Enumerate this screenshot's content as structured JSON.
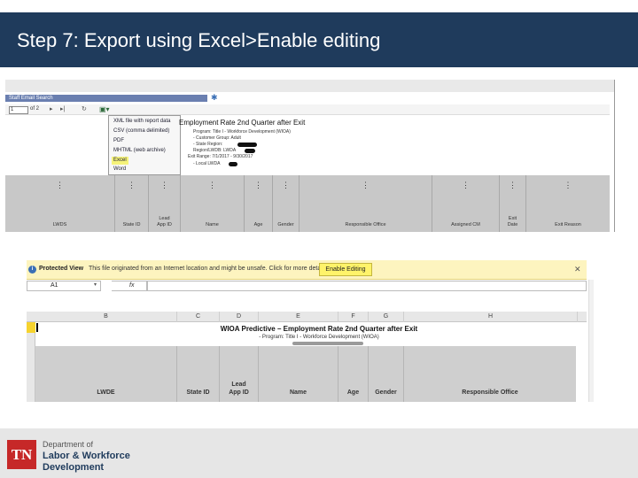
{
  "slide": {
    "title": "Step 7:  Export using Excel>Enable editing"
  },
  "report_viewer": {
    "window_title": "Staff Email Search",
    "page_input": "1",
    "page_of": "of 2",
    "export_menu": [
      "XML file with report data",
      "CSV (comma delimited)",
      "PDF",
      "MHTML (web archive)",
      "Excel",
      "Word"
    ],
    "highlighted_menu_item": "Excel",
    "report_title": "Employment Rate 2nd Quarter after Exit",
    "report_subtitles": [
      "Program: Title I - Workforce Development (WIOA)",
      "- Customer Group: Adult",
      "- State Region:",
      "Region/LWDB: LWDA",
      "Exit Range: 7/1/2017 - 9/30/2017",
      "- Local LWDA"
    ],
    "columns": [
      "LWDS",
      "State ID",
      "Lead\nApp ID",
      "Name",
      "Age",
      "Gender",
      "Responsible Office",
      "Assigned CM",
      "Exit\nDate",
      "Exit Reason"
    ]
  },
  "excel": {
    "protected_view_label": "Protected View",
    "protected_view_message": "This file originated from an Internet location and might be unsafe. Click for more details.",
    "enable_editing_button": "Enable Editing",
    "name_box": "A1",
    "fx_label": "fx",
    "column_letters": [
      "B",
      "C",
      "D",
      "E",
      "F",
      "G",
      "H"
    ],
    "sheet_title": "WIOA Predictive – Employment Rate 2nd Quarter after Exit",
    "sheet_subtitle": "- Program: Title I - Workforce Development (WIOA)",
    "columns": [
      "LWDE",
      "State ID",
      "Lead\nApp ID",
      "Name",
      "Age",
      "Gender",
      "Responsible Office"
    ]
  },
  "footer": {
    "logo_text": "TN",
    "dept_line1": "Department of",
    "dept_line2": "Labor & Workforce",
    "dept_line3": "Development"
  },
  "colors": {
    "title_bar": "#1f3b5c",
    "logo_red": "#c62828",
    "highlight_yellow": "#f5f27a",
    "protected_view_bg": "#fdf4bf"
  }
}
